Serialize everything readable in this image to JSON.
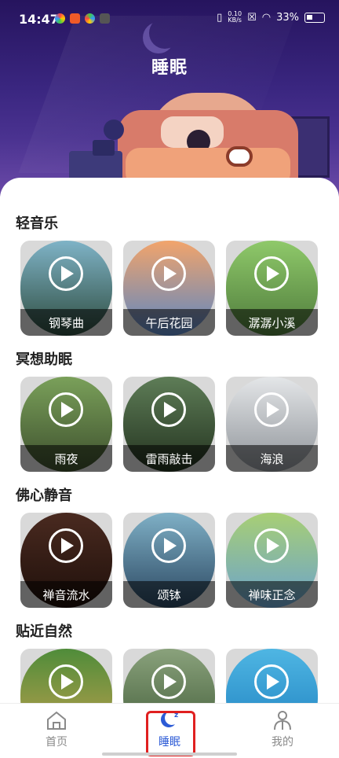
{
  "status_bar": {
    "time": "14:47",
    "net_speed_value": "0.10",
    "net_speed_unit": "KB/s",
    "battery": "33%"
  },
  "page": {
    "title": "睡眠"
  },
  "sections": [
    {
      "title": "轻音乐",
      "cards": [
        {
          "label": "钢琴曲",
          "colors": [
            "#7fb3c7",
            "#2d4b3d"
          ]
        },
        {
          "label": "午后花园",
          "colors": [
            "#f2a46b",
            "#5a86c4"
          ]
        },
        {
          "label": "潺潺小溪",
          "colors": [
            "#8fc96a",
            "#4e7a3b"
          ]
        }
      ]
    },
    {
      "title": "冥想助眠",
      "cards": [
        {
          "label": "雨夜",
          "colors": [
            "#7aa05a",
            "#3d4f2d"
          ]
        },
        {
          "label": "雷雨敲击",
          "colors": [
            "#5e7d57",
            "#23321f"
          ]
        },
        {
          "label": "海浪",
          "colors": [
            "#e4e6e8",
            "#8d9298"
          ]
        }
      ]
    },
    {
      "title": "佛心静音",
      "cards": [
        {
          "label": "禅音流水",
          "colors": [
            "#4a2a20",
            "#1e0f0a"
          ]
        },
        {
          "label": "颂钵",
          "colors": [
            "#7fb0c6",
            "#2a4660"
          ]
        },
        {
          "label": "禅味正念",
          "colors": [
            "#a8cf74",
            "#6aa2cf"
          ]
        }
      ]
    },
    {
      "title": "贴近自然",
      "cards": [
        {
          "label": "",
          "colors": [
            "#4f8c3a",
            "#c2a14d"
          ]
        },
        {
          "label": "",
          "colors": [
            "#8aa27c",
            "#3f5a36"
          ]
        },
        {
          "label": "",
          "colors": [
            "#4fb6e3",
            "#1d7fbf"
          ]
        }
      ]
    }
  ],
  "bottom_nav": {
    "items": [
      {
        "label": "首页",
        "icon": "home-icon"
      },
      {
        "label": "睡眠",
        "icon": "moon-icon",
        "active": true
      },
      {
        "label": "我的",
        "icon": "person-icon"
      }
    ],
    "active_color": "#2c5bd6"
  }
}
